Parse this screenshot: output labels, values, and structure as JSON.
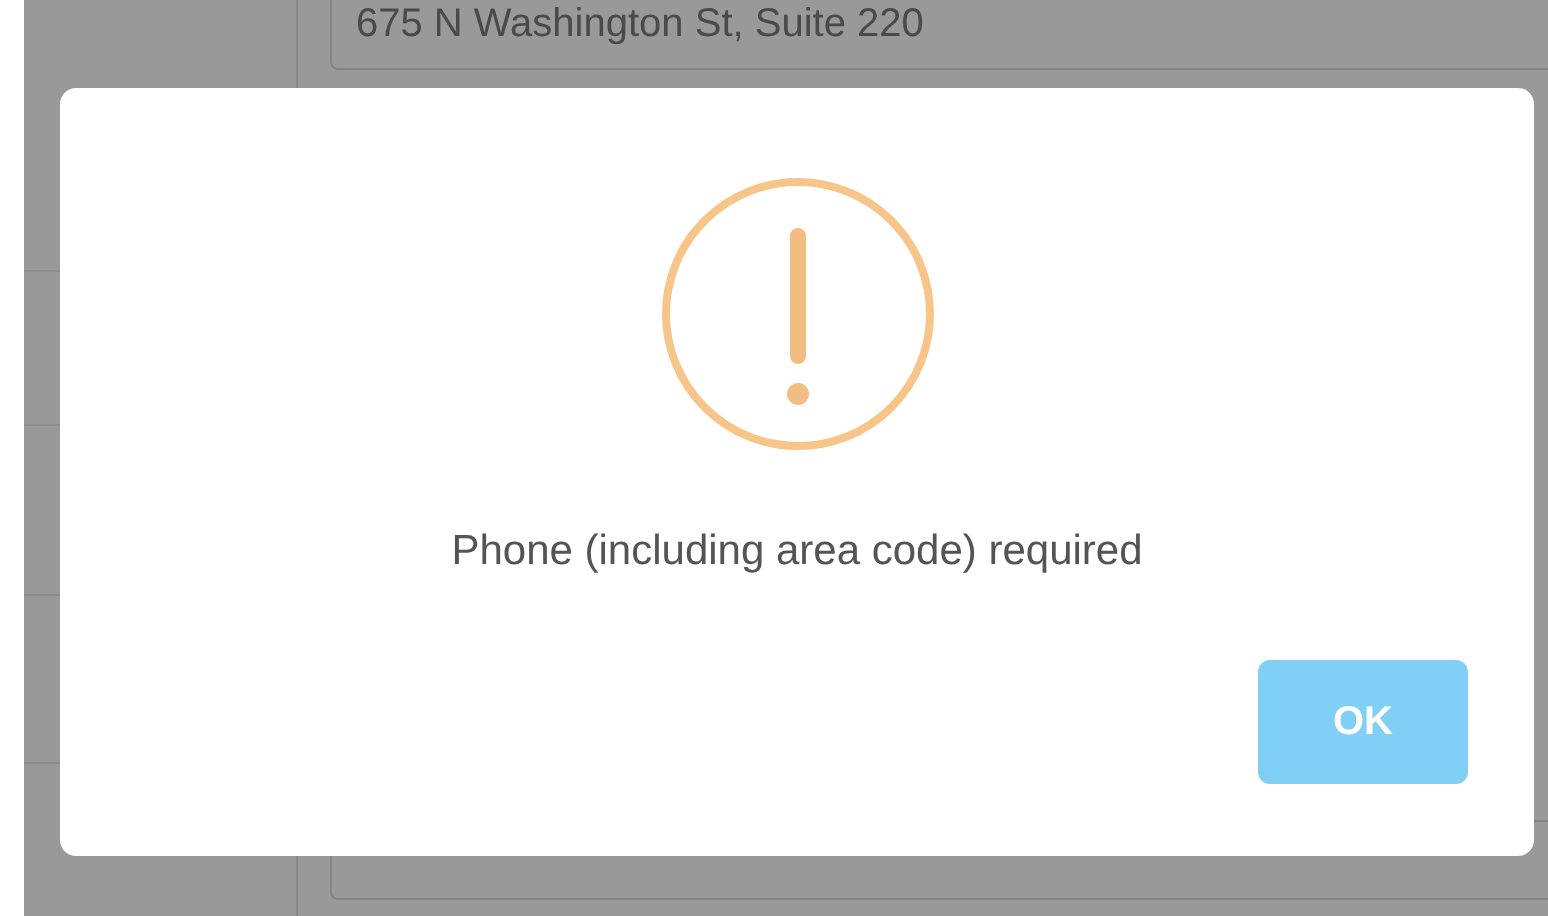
{
  "background_form": {
    "fields": [
      {
        "value": "675 N Washington St, Suite 220"
      }
    ]
  },
  "dialog": {
    "kind": "warning",
    "message": "Phone (including area code) required",
    "buttons": [
      {
        "label": "OK"
      }
    ]
  }
}
